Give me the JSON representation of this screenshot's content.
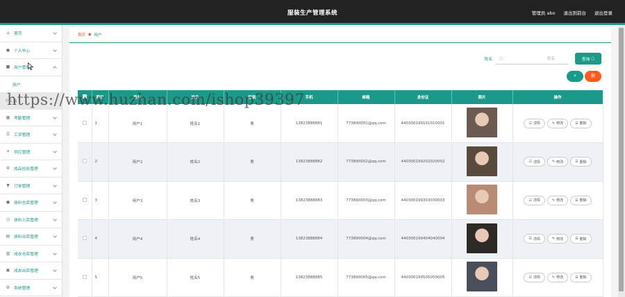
{
  "app": {
    "title": "服装生产管理系统"
  },
  "topbar": {
    "admin": "管理员 abo",
    "exit_backend": "退出到前台",
    "logout": "退出登录"
  },
  "sidebar": {
    "items": [
      {
        "label": "首页",
        "icon": "home-icon",
        "glyph": "⌂"
      },
      {
        "label": "个人中心",
        "icon": "user-icon",
        "glyph": "●"
      },
      {
        "label": "用户管理",
        "icon": "users-icon",
        "glyph": "■",
        "expanded": true
      },
      {
        "label": "用户",
        "sub": true,
        "active": false
      },
      {
        "label": "人事",
        "icon": "person-icon",
        "glyph": "◎",
        "sub": true,
        "active": true
      },
      {
        "label": "考勤管理",
        "icon": "calendar-icon",
        "glyph": "▦"
      },
      {
        "label": "工资管理",
        "icon": "list-icon",
        "glyph": "☰"
      },
      {
        "label": "供应管理",
        "icon": "plane-icon",
        "glyph": "✈"
      },
      {
        "label": "成品检验管理",
        "icon": "gear-icon",
        "glyph": "⚙"
      },
      {
        "label": "订单管理",
        "icon": "pin-icon",
        "glyph": "▼"
      },
      {
        "label": "原料仓库管理",
        "icon": "user-icon",
        "glyph": "●"
      },
      {
        "label": "原料入库管理",
        "icon": "clock-icon",
        "glyph": "◷"
      },
      {
        "label": "原料出库管理",
        "icon": "clipboard-icon",
        "glyph": "▤"
      },
      {
        "label": "成衣仓库管理",
        "icon": "chart-icon",
        "glyph": "▥"
      },
      {
        "label": "成衣出库管理",
        "icon": "archive-icon",
        "glyph": "▣"
      },
      {
        "label": "系统管理",
        "icon": "settings-icon",
        "glyph": "⚙"
      }
    ]
  },
  "breadcrumb": {
    "home": "首页",
    "current": "用户"
  },
  "search": {
    "label": "姓名",
    "placeholder": "姓名",
    "button": "查询"
  },
  "actions": {
    "add": "+",
    "delete": "删"
  },
  "table": {
    "headers": [
      "索引",
      "账号",
      "姓名",
      "性别",
      "手机",
      "邮箱",
      "身份证",
      "照片",
      "操作"
    ],
    "rows": [
      {
        "index": "1",
        "account": "用户1",
        "name": "姓名1",
        "gender": "男",
        "phone": "13823888881",
        "email": "773890001@qq.com",
        "id_card": "440300199101010001",
        "photo_color": "#6b5a52"
      },
      {
        "index": "2",
        "account": "用户2",
        "name": "姓名2",
        "gender": "男",
        "phone": "13823888882",
        "email": "773890002@qq.com",
        "id_card": "440300199202020002",
        "photo_color": "#5a4a3e"
      },
      {
        "index": "3",
        "account": "用户3",
        "name": "姓名3",
        "gender": "男",
        "phone": "13823888883",
        "email": "773890003@qq.com",
        "id_card": "440300199303030003",
        "photo_color": "#b98a74"
      },
      {
        "index": "4",
        "account": "用户4",
        "name": "姓名4",
        "gender": "男",
        "phone": "13823888884",
        "email": "773890004@qq.com",
        "id_card": "440300199404040004",
        "photo_color": "#2e2a28"
      },
      {
        "index": "5",
        "account": "用户5",
        "name": "姓名5",
        "gender": "男",
        "phone": "13823888885",
        "email": "773890005@qq.com",
        "id_card": "440300199505050005",
        "photo_color": "#4a4e5a"
      }
    ],
    "row_actions": {
      "detail": "详情",
      "edit": "修改",
      "delete": "删除"
    }
  },
  "watermark": "https://www.huzhan.com/ishop39397",
  "colors": {
    "accent": "#1a9b8a",
    "topbar": "#222222",
    "danger": "#ff5a1f"
  }
}
